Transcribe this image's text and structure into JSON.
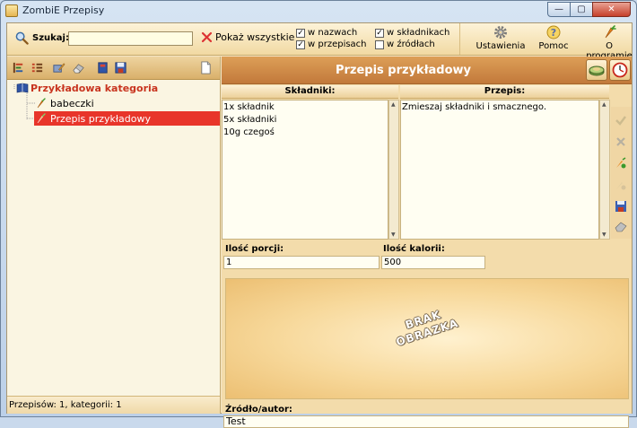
{
  "window": {
    "title": "ZombiE Przepisy"
  },
  "toolbar": {
    "search_label": "Szukaj:",
    "search_value": "",
    "show_all_label": "Pokaż wszystkie",
    "filters": [
      {
        "label": "w nazwach",
        "checked": true
      },
      {
        "label": "w przepisach",
        "checked": true
      },
      {
        "label": "w składnikach",
        "checked": true
      },
      {
        "label": "w źródłach",
        "checked": false
      }
    ],
    "buttons": {
      "settings": "Ustawienia",
      "help": "Pomoc",
      "about": "O programie"
    },
    "colors": {
      "accent": "#c2793b",
      "selection": "#e8352a"
    }
  },
  "tree": {
    "category": "Przykładowa kategoria",
    "items": [
      "babeczki",
      "Przepis przykładowy"
    ],
    "selected_index": 1
  },
  "status": {
    "text": "Przepisów: 1, kategorii: 1"
  },
  "recipe": {
    "title": "Przepis przykładowy",
    "ingredients_header": "Składniki:",
    "ingredients_lines": [
      "1x składnik",
      "5x składniki",
      "10g czegoś"
    ],
    "method_header": "Przepis:",
    "method_text": "Zmieszaj składniki i smacznego.",
    "portions_label": "Ilość porcji:",
    "portions_value": "1",
    "calories_label": "Ilość kalorii:",
    "calories_value": "500",
    "no_image_line1": "BRAK",
    "no_image_line2": "OBRAZKA",
    "source_label": "Źródło/autor:",
    "source_value": "Test"
  }
}
